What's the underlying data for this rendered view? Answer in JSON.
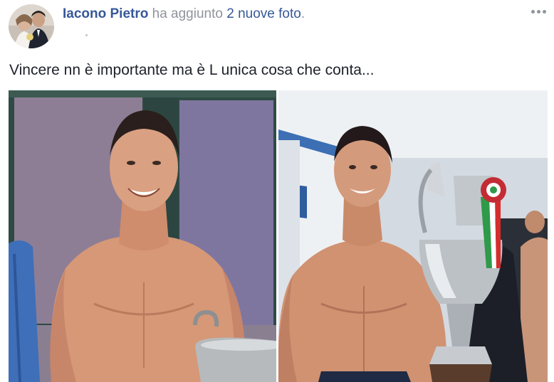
{
  "post": {
    "author": "Iacono Pietro",
    "action_prefix": "ha aggiunto",
    "count": "2",
    "action_suffix": "nuove foto",
    "punct": ".",
    "caption": "Vincere nn è importante ma è L unica cosa che conta...",
    "more_icon": "more-horizontal-icon"
  },
  "colors": {
    "link": "#365899",
    "meta": "#90949c",
    "text": "#1d2129"
  }
}
